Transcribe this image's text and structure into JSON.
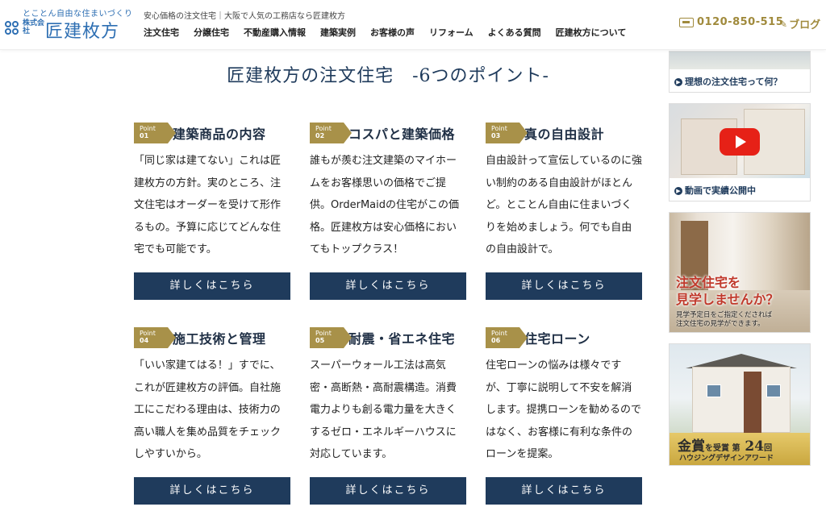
{
  "header": {
    "logo": {
      "tagline": "とことん自由な住まいづくり",
      "company_type": "株式会社",
      "name": "匠建枚方"
    },
    "tagline": "安心価格の注文住宅｜大阪で人気の工務店なら匠建枚方",
    "nav": [
      "注文住宅",
      "分譲住宅",
      "不動産購入情報",
      "建築実例",
      "お客様の声",
      "リフォーム",
      "よくある質問",
      "匠建枚方について"
    ],
    "phone": "0120-850-515",
    "blog": "ブログ"
  },
  "main": {
    "title": "匠建枚方の注文住宅　-6つのポイント-",
    "points": [
      {
        "badge_label": "Point",
        "badge_num": "01",
        "title": "建築商品の内容",
        "body": "「同じ家は建てない」これは匠建枚方の方針。実のところ、注文住宅はオーダーを受けて形作るもの。予算に応じてどんな住宅でも可能です。",
        "button": "詳しくはこちら"
      },
      {
        "badge_label": "Point",
        "badge_num": "02",
        "title": "コスパと建築価格",
        "body": "誰もが羨む注文建築のマイホームをお客様思いの価格でご提供。OrderMaidの住宅がこの価格。匠建枚方は安心価格においてもトップクラス！",
        "button": "詳しくはこちら"
      },
      {
        "badge_label": "Point",
        "badge_num": "03",
        "title": "真の自由設計",
        "body": "自由設計って宣伝しているのに強い制約のある自由設計がほとんど。とことん自由に住まいづくりを始めましょう。何でも自由の自由設計で。",
        "button": "詳しくはこちら"
      },
      {
        "badge_label": "Point",
        "badge_num": "04",
        "title": "施工技術と管理",
        "body": "「いい家建てはる！」すでに、これが匠建枚方の評価。自社施工にこだわる理由は、技術力の高い職人を集め品質をチェックしやすいから。",
        "button": "詳しくはこちら"
      },
      {
        "badge_label": "Point",
        "badge_num": "05",
        "title": "耐震・省エネ住宅",
        "body": "スーパーウォール工法は高気密・高断熱・高耐震構造。消費電力よりも創る電力量を大きくするゼロ・エネルギーハウスに対応しています。",
        "button": "詳しくはこちら"
      },
      {
        "badge_label": "Point",
        "badge_num": "06",
        "title": "住宅ローン",
        "body": "住宅ローンの悩みは様々ですが、丁寧に説明して不安を解消します。提携ローンを勧めるのではなく、お客様に有利な条件のローンを提案。",
        "button": "詳しくはこちら"
      }
    ]
  },
  "sidebar": {
    "banner1_label": "理想の注文住宅って何？",
    "banner2_label": "動画で実績公開中",
    "banner3_title_line1": "注文住宅を",
    "banner3_title_line2": "見学しませんか？",
    "banner3_note_line1": "見学予定日をご指定くだされば",
    "banner3_note_line2": "注文住宅の見学ができます。",
    "banner4_award_a": "金賞",
    "banner4_award_b": "を受賞 第",
    "banner4_award_num": "24",
    "banner4_award_c": "回",
    "banner4_sub": "ハウジングデザインアワード"
  },
  "colors": {
    "navy": "#1f3b5c",
    "gold": "#a89149",
    "logo_blue": "#2e6fb3"
  }
}
